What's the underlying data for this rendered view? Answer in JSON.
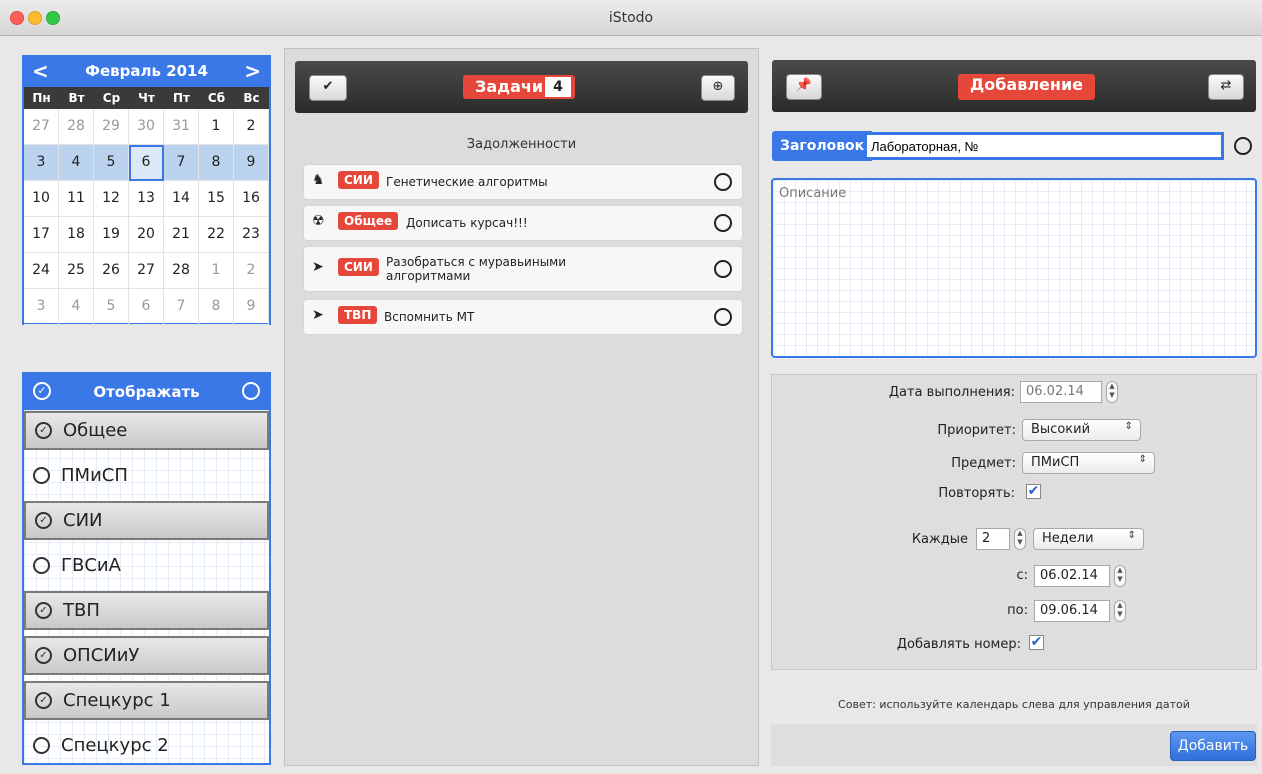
{
  "window": {
    "title": "iStodo"
  },
  "calendar": {
    "month_label": "Февраль 2014",
    "weekdays": [
      "Пн",
      "Вт",
      "Ср",
      "Чт",
      "Пт",
      "Сб",
      "Вс"
    ],
    "days": [
      "27",
      "28",
      "29",
      "30",
      "31",
      "1",
      "2",
      "3",
      "4",
      "5",
      "6",
      "7",
      "8",
      "9",
      "10",
      "11",
      "12",
      "13",
      "14",
      "15",
      "16",
      "17",
      "18",
      "19",
      "20",
      "21",
      "22",
      "23",
      "24",
      "25",
      "26",
      "27",
      "28",
      "1",
      "2",
      "3",
      "4",
      "5",
      "6",
      "7",
      "8",
      "9"
    ],
    "selected_day": "6"
  },
  "filter": {
    "title": "Отображать",
    "items": [
      {
        "label": "Общее",
        "on": true
      },
      {
        "label": "ПМиСП",
        "on": false
      },
      {
        "label": "СИИ",
        "on": true
      },
      {
        "label": "ГВСиА",
        "on": false
      },
      {
        "label": "ТВП",
        "on": true
      },
      {
        "label": "ОПСИиУ",
        "on": true
      },
      {
        "label": "Спецкурс 1",
        "on": true
      },
      {
        "label": "Спецкурс 2",
        "on": false
      }
    ]
  },
  "tasks": {
    "title": "Задачи",
    "count": "4",
    "section": "Задолженности",
    "items": [
      {
        "icon": "rocket-icon",
        "glyph": "♞",
        "tag": "СИИ",
        "text": "Генетические алгоритмы"
      },
      {
        "icon": "radiation-icon",
        "glyph": "☢",
        "tag": "Общее",
        "text": "Дописать курсач!!!"
      },
      {
        "icon": "paper-plane-icon",
        "glyph": "➤",
        "tag": "СИИ",
        "text": "Разобраться с муравьиными алгоритмами"
      },
      {
        "icon": "paper-plane-icon",
        "glyph": "➤",
        "tag": "ТВП",
        "text": "Вспомнить МТ"
      }
    ]
  },
  "add": {
    "title": "Добавление",
    "title_label": "Заголовок",
    "title_value": "Лабораторная, №",
    "desc_placeholder": "Описание",
    "due_label": "Дата выполнения:",
    "due_value": "06.02.14",
    "priority_label": "Приоритет:",
    "priority_value": "Высокий",
    "subject_label": "Предмет:",
    "subject_value": "ПМиСП",
    "repeat_label": "Повторять:",
    "repeat_checked": true,
    "every_label": "Каждые",
    "every_value": "2",
    "period_value": "Недели",
    "from_label": "с:",
    "from_value": "06.02.14",
    "to_label": "по:",
    "to_value": "09.06.14",
    "number_label": "Добавлять номер:",
    "number_checked": true,
    "hint": "Совет: используйте календарь слева для управления датой",
    "add_button": "Добавить"
  },
  "colors": {
    "accent": "#3b78e7",
    "tag": "#e5473b"
  }
}
